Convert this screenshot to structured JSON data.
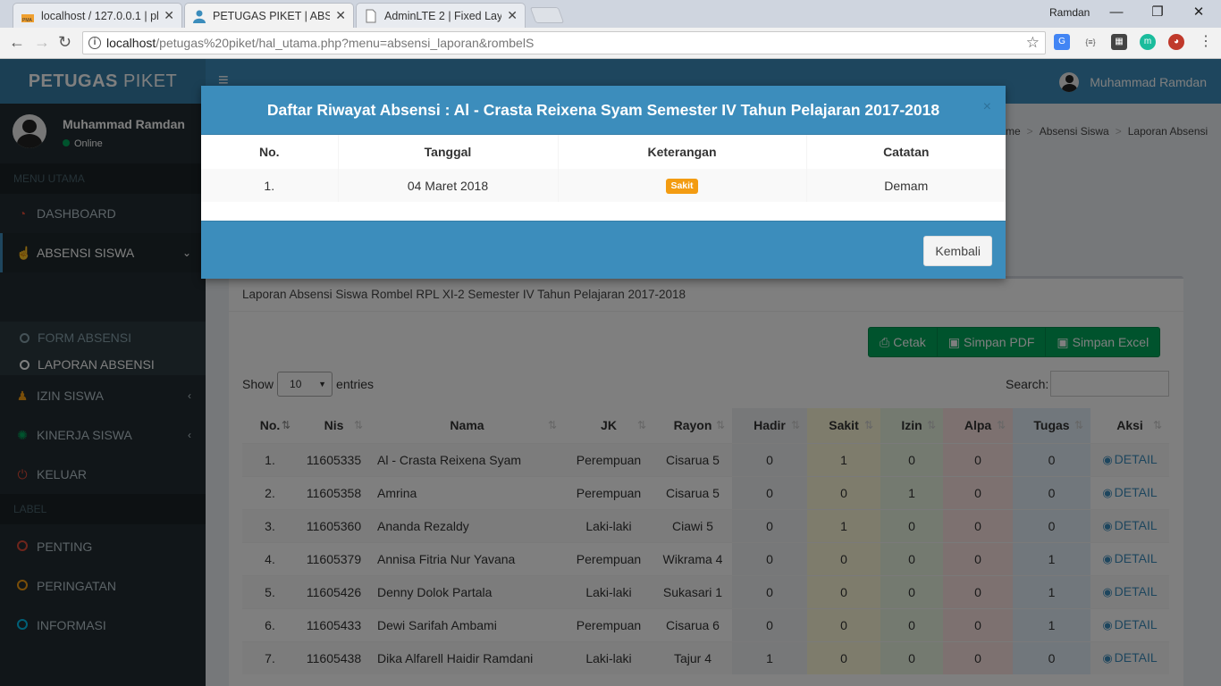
{
  "browser": {
    "tabs": [
      {
        "title": "localhost / 127.0.0.1 | php",
        "icon": "phpmyadmin-icon"
      },
      {
        "title": "PETUGAS PIKET | ABSENS",
        "icon": "user-icon"
      },
      {
        "title": "AdminLTE 2 | Fixed Layou",
        "icon": "page-icon"
      }
    ],
    "window_user": "Ramdan",
    "url_host": "localhost",
    "url_path": "/petugas%20piket/hal_utama.php?menu=absensi_laporan&rombelS"
  },
  "app": {
    "logo_bold": "PETUGAS",
    "logo_rest": " PIKET",
    "user_name": "Muhammad Ramdan",
    "user_status": "Online",
    "menu_header": "MENU UTAMA",
    "label_header": "LABEL",
    "menu": {
      "dashboard": "DASHBOARD",
      "absensi": "ABSENSI SISWA",
      "form_absensi": "FORM ABSENSI",
      "laporan_absensi": "LAPORAN ABSENSI",
      "izin": "IZIN SISWA",
      "kinerja": "KINERJA SISWA",
      "keluar": "KELUAR",
      "penting": "PENTING",
      "peringatan": "PERINGATAN",
      "informasi": "INFORMASI"
    },
    "colors": {
      "brand": "#3c8dbc",
      "sidebar": "#222d32",
      "success": "#00a65a",
      "warning": "#f39c12"
    }
  },
  "breadcrumb": {
    "home": "me",
    "absensi": "Absensi Siswa",
    "laporan": "Laporan Absensi"
  },
  "report": {
    "title": "Laporan Absensi Siswa Rombel RPL XI-2 Semester IV Tahun Pelajaran 2017-2018",
    "buttons": {
      "cetak": "Cetak",
      "pdf": "Simpan PDF",
      "excel": "Simpan Excel"
    },
    "show_label": "Show",
    "entries_value": "10",
    "entries_label": "entries",
    "search_label": "Search:",
    "columns": [
      "No.",
      "Nis",
      "Nama",
      "JK",
      "Rayon",
      "Hadir",
      "Sakit",
      "Izin",
      "Alpa",
      "Tugas",
      "Aksi"
    ],
    "detail_label": "DETAIL",
    "rows": [
      {
        "no": "1.",
        "nis": "11605335",
        "nama": "Al - Crasta Reixena Syam",
        "jk": "Perempuan",
        "rayon": "Cisarua 5",
        "hadir": "0",
        "sakit": "1",
        "izin": "0",
        "alpa": "0",
        "tugas": "0"
      },
      {
        "no": "2.",
        "nis": "11605358",
        "nama": "Amrina",
        "jk": "Perempuan",
        "rayon": "Cisarua 5",
        "hadir": "0",
        "sakit": "0",
        "izin": "1",
        "alpa": "0",
        "tugas": "0"
      },
      {
        "no": "3.",
        "nis": "11605360",
        "nama": "Ananda Rezaldy",
        "jk": "Laki-laki",
        "rayon": "Ciawi 5",
        "hadir": "0",
        "sakit": "1",
        "izin": "0",
        "alpa": "0",
        "tugas": "0"
      },
      {
        "no": "4.",
        "nis": "11605379",
        "nama": "Annisa Fitria Nur Yavana",
        "jk": "Perempuan",
        "rayon": "Wikrama 4",
        "hadir": "0",
        "sakit": "0",
        "izin": "0",
        "alpa": "0",
        "tugas": "1"
      },
      {
        "no": "5.",
        "nis": "11605426",
        "nama": "Denny Dolok Partala",
        "jk": "Laki-laki",
        "rayon": "Sukasari 1",
        "hadir": "0",
        "sakit": "0",
        "izin": "0",
        "alpa": "0",
        "tugas": "1"
      },
      {
        "no": "6.",
        "nis": "11605433",
        "nama": "Dewi Sarifah Ambami",
        "jk": "Perempuan",
        "rayon": "Cisarua 6",
        "hadir": "0",
        "sakit": "0",
        "izin": "0",
        "alpa": "0",
        "tugas": "1"
      },
      {
        "no": "7.",
        "nis": "11605438",
        "nama": "Dika Alfarell Haidir Ramdani",
        "jk": "Laki-laki",
        "rayon": "Tajur 4",
        "hadir": "1",
        "sakit": "0",
        "izin": "0",
        "alpa": "0",
        "tugas": "0"
      }
    ]
  },
  "modal": {
    "title": "Daftar Riwayat Absensi : Al - Crasta Reixena Syam Semester IV Tahun Pelajaran 2017-2018",
    "close": "×",
    "columns": [
      "No.",
      "Tanggal",
      "Keterangan",
      "Catatan"
    ],
    "rows": [
      {
        "no": "1.",
        "tanggal": "04 Maret 2018",
        "keterangan": "Sakit",
        "catatan": "Demam"
      }
    ],
    "back_label": "Kembali"
  }
}
